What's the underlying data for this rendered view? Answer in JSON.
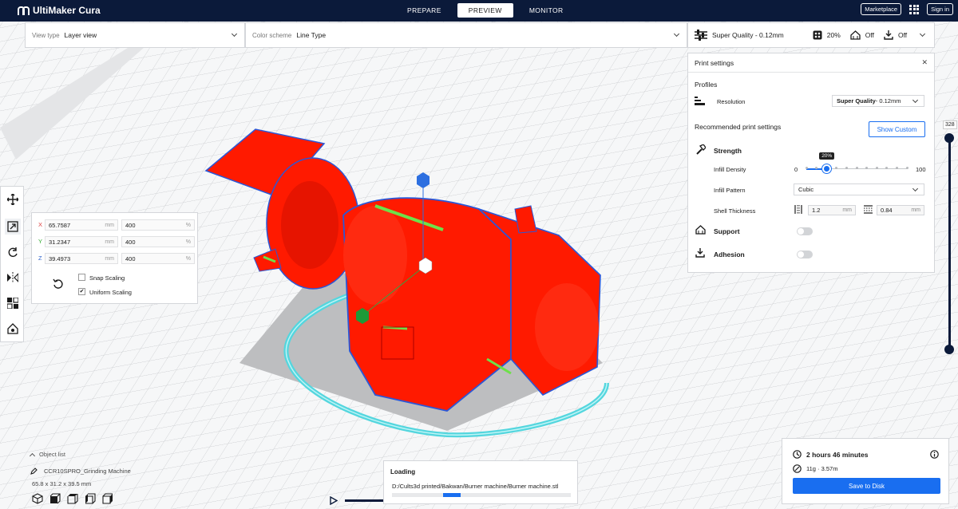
{
  "app": {
    "title": "UltiMaker Cura"
  },
  "stages": [
    {
      "label": "PREPARE"
    },
    {
      "label": "PREVIEW"
    },
    {
      "label": "MONITOR"
    }
  ],
  "topright": {
    "marketplace": "Marketplace",
    "signin": "Sign in"
  },
  "viewtype": {
    "label": "View type",
    "value": "Layer view"
  },
  "colorscheme": {
    "label": "Color scheme",
    "value": "Line Type"
  },
  "printheader": {
    "profile": "Super Quality - 0.12mm",
    "infill": "20%",
    "support": "Off",
    "adhesion": "Off"
  },
  "panel": {
    "title": "Print settings",
    "profiles": "Profiles",
    "resolution_label": "Resolution",
    "resolution_bold": "Super Quality",
    "resolution_rest": " - 0.12mm",
    "recommended": "Recommended print settings",
    "show_custom": "Show Custom",
    "strength": "Strength",
    "infill_density": "Infill Density",
    "infill_min": "0",
    "infill_max": "100",
    "infill_tooltip": "20%",
    "infill_value": 20,
    "infill_pattern_label": "Infill Pattern",
    "infill_pattern": "Cubic",
    "shell_label": "Shell Thickness",
    "shell_wall": "1.2",
    "shell_top": "0.84",
    "unit_mm": "mm",
    "support": "Support",
    "adhesion": "Adhesion"
  },
  "scale": {
    "x_label": "X",
    "x_value": "65.7587",
    "x_pct": "400",
    "y_label": "Y",
    "y_value": "31.2347",
    "y_pct": "400",
    "z_label": "Z",
    "z_value": "39.4973",
    "z_pct": "400",
    "unit_mm": "mm",
    "unit_pct": "%",
    "snap": "Snap Scaling",
    "uniform": "Uniform Scaling",
    "uniform_check": "✔"
  },
  "layer": {
    "current": "328"
  },
  "objectlist": {
    "label": "Object list",
    "name": "CCR10SPRO_Grinding Machine",
    "dims": "65.8 x 31.2 x 39.5 mm"
  },
  "loading": {
    "title": "Loading",
    "path": "D:/Cults3d printed/Bakwan/Burner machine/Burner machine.stl"
  },
  "estimate": {
    "time": "2 hours 46 minutes",
    "material": "11g · 3.57m",
    "save": "Save to Disk"
  }
}
